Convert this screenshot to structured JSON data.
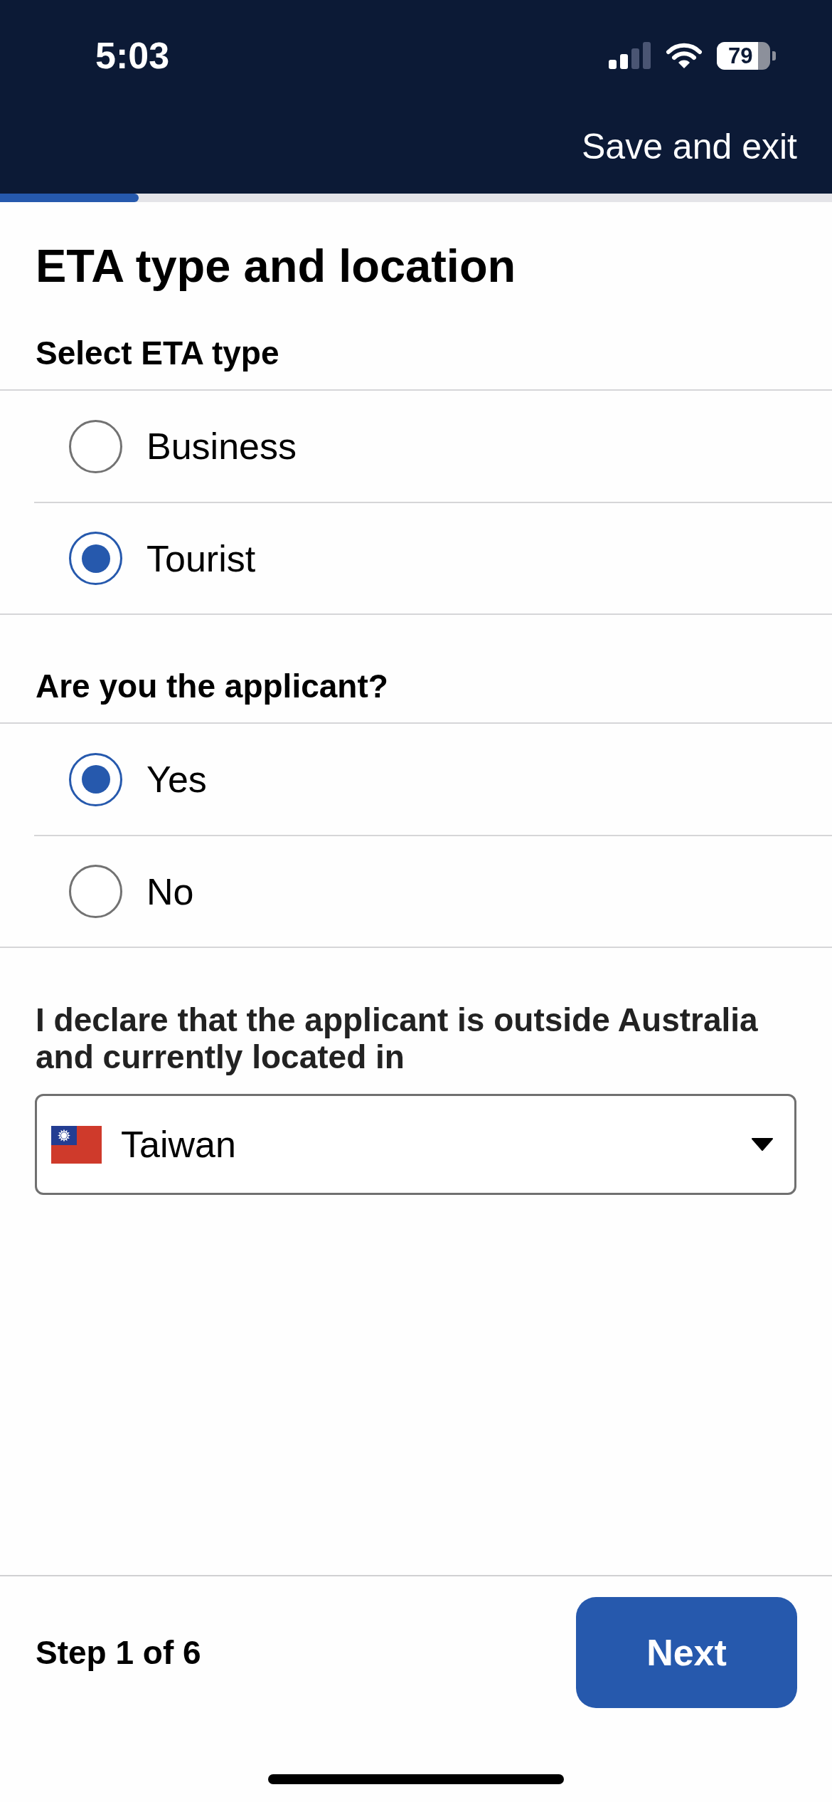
{
  "status_bar": {
    "time": "5:03",
    "battery": "79"
  },
  "header": {
    "action": "Save and exit"
  },
  "progress": {
    "level": 0.167
  },
  "title": "ETA type and location",
  "groups": [
    {
      "label": "Select ETA type",
      "options": [
        {
          "label": "Business",
          "selected": false
        },
        {
          "label": "Tourist",
          "selected": true
        }
      ]
    },
    {
      "label": "Are you the applicant?",
      "options": [
        {
          "label": "Yes",
          "selected": true
        },
        {
          "label": "No",
          "selected": false
        }
      ]
    }
  ],
  "location": {
    "label": "I declare that the applicant is outside Australia and currently located in",
    "select": {
      "value": "Taiwan"
    }
  },
  "footer": {
    "step": "Step 1 of 6",
    "button": "Next"
  }
}
